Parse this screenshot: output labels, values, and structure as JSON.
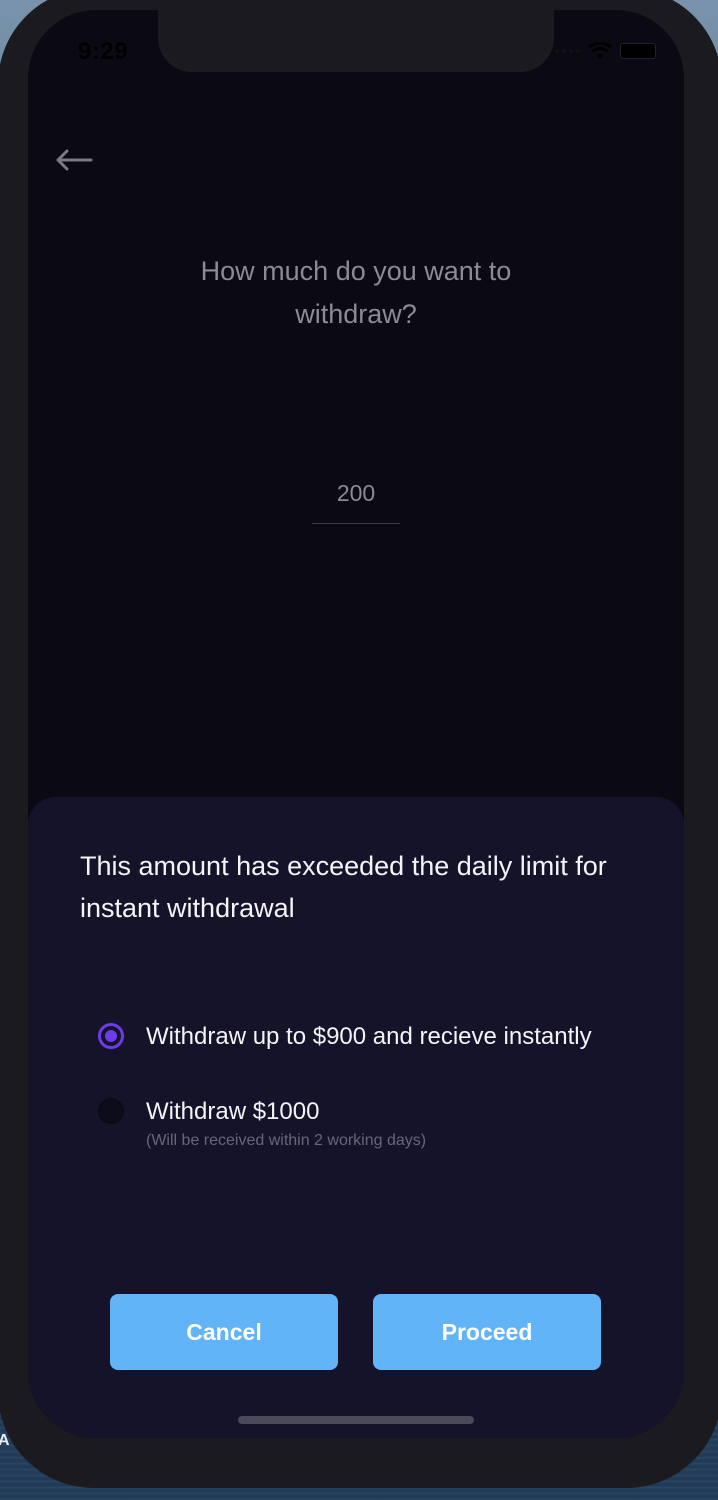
{
  "status_bar": {
    "time": "9:29",
    "icons": [
      "signal-icon",
      "wifi-icon",
      "battery-icon"
    ]
  },
  "header": {
    "back_icon": "arrow-left-icon"
  },
  "prompt": {
    "line1": "How much do you want to",
    "line2": "withdraw?"
  },
  "amount": {
    "value": "200"
  },
  "sheet": {
    "title": "This amount has exceeded the daily limit for instant withdrawal",
    "options": [
      {
        "label": "Withdraw up to $900 and recieve instantly",
        "sublabel": "",
        "selected": true
      },
      {
        "label": "Withdraw $1000",
        "sublabel": "(Will be received within 2 working days)",
        "selected": false
      }
    ],
    "cancel_label": "Cancel",
    "proceed_label": "Proceed"
  },
  "colors": {
    "background": "#0a0914",
    "sheet": "#14132a",
    "accent": "#6d3ce8",
    "button": "#62b4f8"
  }
}
